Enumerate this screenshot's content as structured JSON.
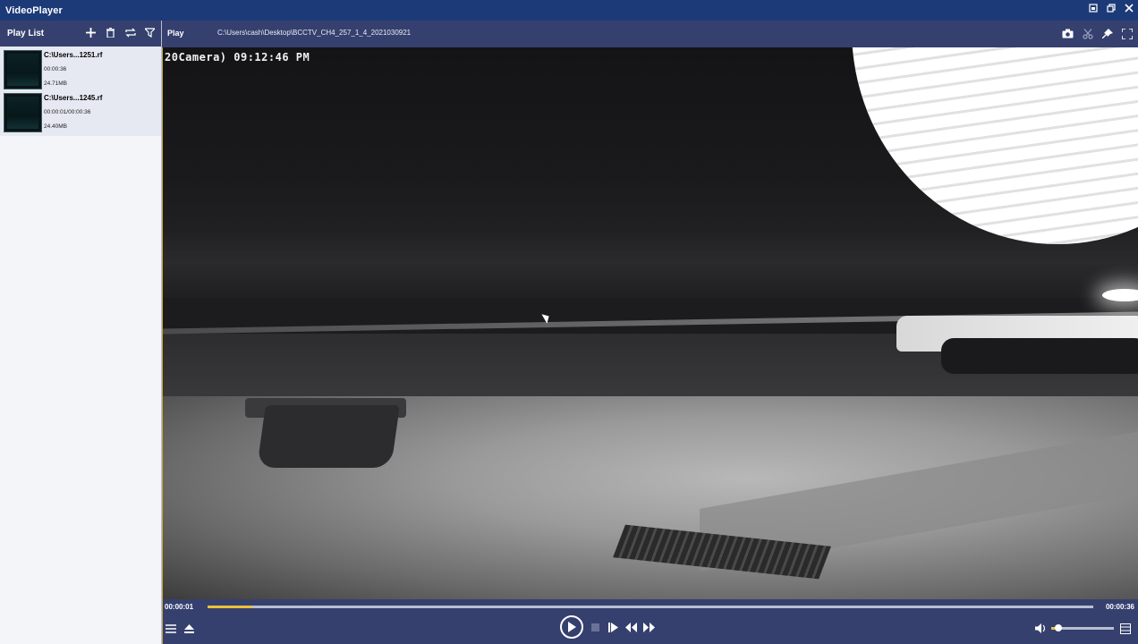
{
  "app": {
    "title": "VideoPlayer"
  },
  "window_controls": [
    "restore",
    "maximize",
    "close"
  ],
  "sidebar": {
    "header_label": "Play List",
    "items": [
      {
        "name": "C:\\Users...1251.rf",
        "duration": "00:00:36",
        "size": "24.71MB"
      },
      {
        "name": "C:\\Users...1245.rf",
        "duration": "00:00:01/00:00:36",
        "size": "24.40MB"
      }
    ]
  },
  "main": {
    "play_label": "Play",
    "file_path": "C:\\Users\\cash\\Desktop\\BCCTV_CH4_257_1_4_2021030921"
  },
  "video": {
    "osd_text": "20Camera) 09:12:46 PM"
  },
  "controls": {
    "time_current": "00:00:01",
    "time_total": "00:00:36",
    "progress": 0.05,
    "volume": 0.12
  },
  "colors": {
    "titlebar": "#1d3a78",
    "bar": "#36406e",
    "accent": "#e8c23a"
  }
}
